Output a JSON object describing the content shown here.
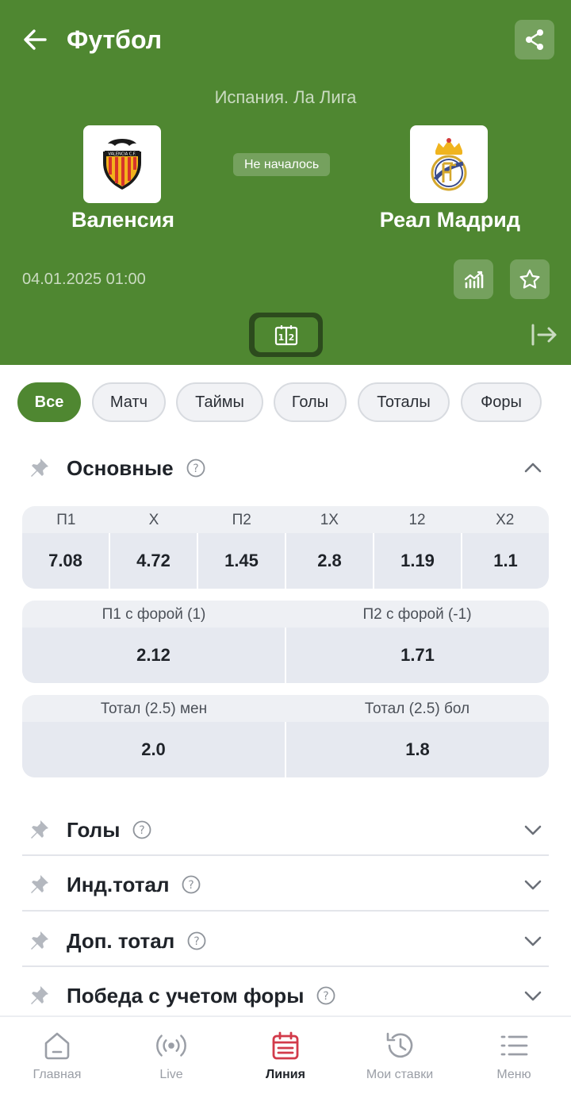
{
  "header": {
    "title": "Футбол",
    "league": "Испания. Ла Лига",
    "status": "Не началось",
    "date": "04.01.2025 01:00",
    "home_team": {
      "name": "Валенсия",
      "logo_text": "VALENCIA C.F."
    },
    "away_team": {
      "name": "Реал Мадрид"
    },
    "scoreboard_label": "1|2"
  },
  "filters": [
    {
      "label": "Все",
      "active": true
    },
    {
      "label": "Матч",
      "active": false
    },
    {
      "label": "Таймы",
      "active": false
    },
    {
      "label": "Голы",
      "active": false
    },
    {
      "label": "Тоталы",
      "active": false
    },
    {
      "label": "Форы",
      "active": false
    }
  ],
  "main_section": {
    "title": "Основные",
    "outcomes": [
      {
        "label": "П1",
        "value": "7.08"
      },
      {
        "label": "X",
        "value": "4.72"
      },
      {
        "label": "П2",
        "value": "1.45"
      },
      {
        "label": "1X",
        "value": "2.8"
      },
      {
        "label": "12",
        "value": "1.19"
      },
      {
        "label": "X2",
        "value": "1.1"
      }
    ],
    "handicap": [
      {
        "label": "П1 с форой (1)",
        "value": "2.12"
      },
      {
        "label": "П2 с форой (-1)",
        "value": "1.71"
      }
    ],
    "totals": [
      {
        "label": "Тотал (2.5) мен",
        "value": "2.0"
      },
      {
        "label": "Тотал (2.5) бол",
        "value": "1.8"
      }
    ]
  },
  "collapsed_sections": [
    {
      "title": "Голы"
    },
    {
      "title": "Инд.тотал"
    },
    {
      "title": "Доп. тотал"
    },
    {
      "title": "Победа с учетом форы"
    }
  ],
  "bottom_nav": [
    {
      "label": "Главная",
      "icon": "home-icon",
      "active": false
    },
    {
      "label": "Live",
      "icon": "live-icon",
      "active": false
    },
    {
      "label": "Линия",
      "icon": "calendar-icon",
      "active": true
    },
    {
      "label": "Мои ставки",
      "icon": "history-icon",
      "active": false
    },
    {
      "label": "Меню",
      "icon": "menu-icon",
      "active": false
    }
  ],
  "colors": {
    "brand_green": "#4f8731",
    "active_nav": "#d23a4a"
  }
}
